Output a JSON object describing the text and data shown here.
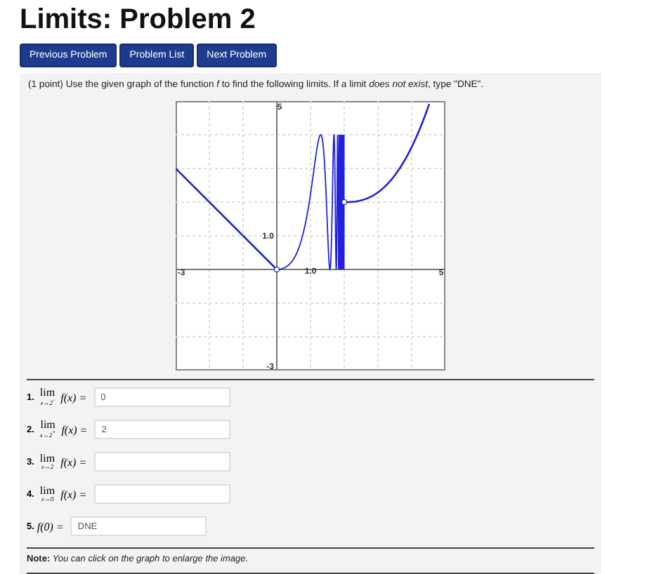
{
  "title": "Limits: Problem 2",
  "nav_buttons": [
    "Previous Problem",
    "Problem List",
    "Next Problem"
  ],
  "prompt": "(1 point) Use the given graph of the function *f* to find the following limits. If a limit *does not exist*, type \"DNE\".",
  "graph": {
    "labels": [
      {
        "kind": "y_max",
        "text": "5"
      },
      {
        "kind": "y_min",
        "text": "-3"
      },
      {
        "kind": "x_min",
        "text": "-3"
      },
      {
        "kind": "x_max",
        "text": "5"
      },
      {
        "kind": "y_tick",
        "text": "1.0"
      },
      {
        "kind": "x_tick",
        "text": "1.0"
      }
    ]
  },
  "questions": [
    {
      "kind": "limit",
      "number": "1.",
      "lim": "lim",
      "sub": "x→2$^{-}$",
      "expr": "f(x) =",
      "value": "0"
    },
    {
      "kind": "limit",
      "number": "2.",
      "lim": "lim",
      "sub": "x→2$^{+}$",
      "expr": "f(x) =",
      "value": "2"
    },
    {
      "kind": "limit",
      "number": "3.",
      "lim": "lim",
      "sub": "x→2",
      "expr": "f(x) ="
    },
    {
      "kind": "limit",
      "number": "4.",
      "lim": "lim",
      "sub": "x→0",
      "expr": "f(x) ="
    },
    {
      "kind": "value",
      "number": "5.",
      "expr": "f(0) =",
      "value": "DNE"
    }
  ],
  "note": "**Note:** *You can click on the graph to enlarge the image.*"
}
